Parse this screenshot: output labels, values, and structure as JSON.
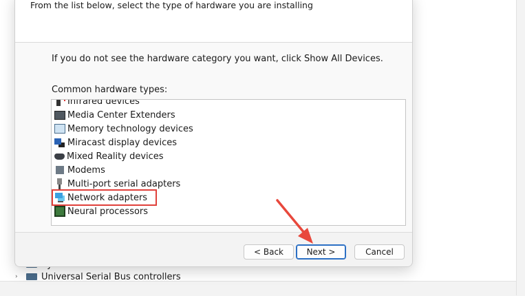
{
  "background": {
    "tree_items": [
      {
        "label": "System devices"
      },
      {
        "label": "Universal Serial Bus controllers"
      }
    ]
  },
  "dialog": {
    "subtitle": "From the list below, select the type of hardware you are installing",
    "info_text": "If you do not see the hardware category you want, click Show All Devices.",
    "list_label": "Common hardware types:",
    "hardware_types": [
      {
        "label": "Infrared devices",
        "icon": "infrared-icon"
      },
      {
        "label": "Media Center Extenders",
        "icon": "media-center-icon"
      },
      {
        "label": "Memory technology devices",
        "icon": "memory-icon"
      },
      {
        "label": "Miracast display devices",
        "icon": "miracast-icon"
      },
      {
        "label": "Mixed Reality devices",
        "icon": "mixed-reality-icon"
      },
      {
        "label": "Modems",
        "icon": "modem-icon"
      },
      {
        "label": "Multi-port serial adapters",
        "icon": "serial-port-icon"
      },
      {
        "label": "Network adapters",
        "icon": "network-adapter-icon",
        "highlighted": true
      },
      {
        "label": "Neural processors",
        "icon": "neural-processor-icon"
      }
    ],
    "buttons": {
      "back": "< Back",
      "next": "Next >",
      "cancel": "Cancel"
    }
  },
  "annotation": {
    "highlight_color": "#e0403a",
    "arrow_color": "#e8483c"
  }
}
